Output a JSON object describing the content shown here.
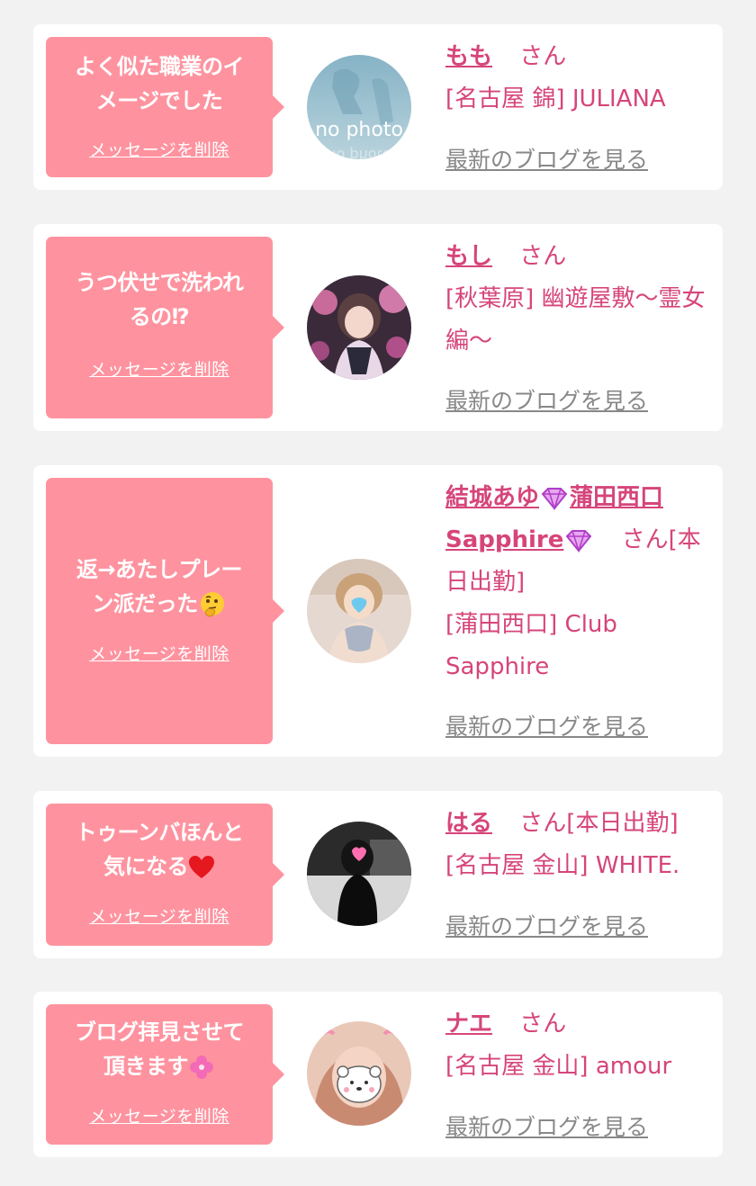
{
  "colors": {
    "page_background": "#f2f2f2",
    "card_background": "#ffffff",
    "bubble_pink": "#fe939f",
    "accent_pink": "#d6457a",
    "link_gray": "#888888"
  },
  "messages": [
    {
      "message_lines": [
        "よく似た職業のイ",
        "メージでした"
      ],
      "message_emoji": "",
      "delete_label": "メッセージを削除",
      "avatar": "no-photo",
      "avatar_text": "no photo",
      "name": "もも",
      "name_emoji": "",
      "san": "さん",
      "status": "",
      "shop": "[名古屋 錦] JULIANA",
      "blog_label": "最新のブログを見る"
    },
    {
      "message_lines": [
        "うつ伏せで洗われ",
        "るの⁉"
      ],
      "message_emoji": "",
      "delete_label": "メッセージを削除",
      "avatar": "photo-girl-floral",
      "name": "もし",
      "name_emoji": "",
      "san": "さん",
      "status": "",
      "shop": "[秋葉原] 幽遊屋敷〜霊女編〜",
      "blog_label": "最新のブログを見る"
    },
    {
      "message_lines": [
        "返→あたしプレー",
        "ン派だった"
      ],
      "message_emoji": "thinking-face-icon",
      "delete_label": "メッセージを削除",
      "avatar": "photo-girl-blue-heart",
      "name_part1": "結城あゆ",
      "name_part2": "蒲田西口",
      "name_part3": "Sapphire",
      "name_emoji": "gem-icon",
      "san": "さん",
      "status": "[本日出勤]",
      "shop": "[蒲田西口] Club Sapphire",
      "blog_label": "最新のブログを見る"
    },
    {
      "message_lines": [
        "トゥーンバほんと",
        "気になる"
      ],
      "message_emoji": "red-heart-icon",
      "delete_label": "メッセージを削除",
      "avatar": "photo-girl-pink-heart",
      "name": "はる",
      "name_emoji": "",
      "san": "さん",
      "status": "[本日出勤]",
      "shop": "[名古屋 金山] WHITE.",
      "blog_label": "最新のブログを見る"
    },
    {
      "message_lines": [
        "ブログ拝見させて",
        "頂きます"
      ],
      "message_emoji": "clover-icon",
      "delete_label": "メッセージを削除",
      "avatar": "photo-girl-bear",
      "name": "ナエ",
      "name_emoji": "",
      "san": "さん",
      "status": "",
      "shop": "[名古屋 金山] amour",
      "blog_label": "最新のブログを見る"
    }
  ]
}
